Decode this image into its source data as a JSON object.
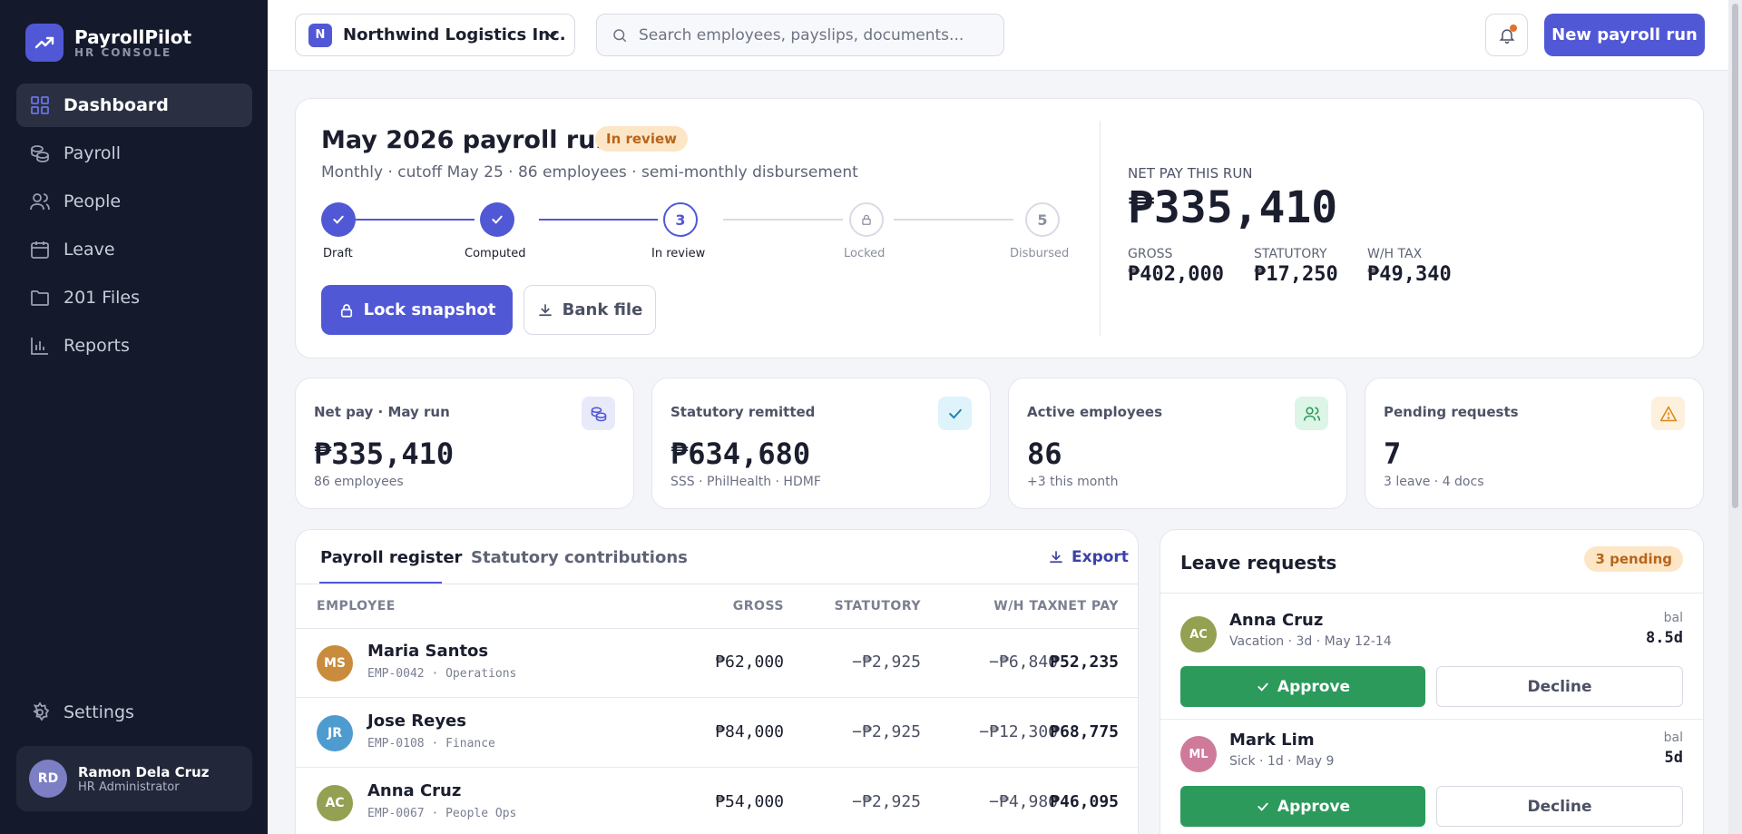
{
  "brand": {
    "name": "PayrollPilot",
    "subtitle": "HR CONSOLE"
  },
  "sidebar": {
    "items": [
      {
        "label": "Dashboard",
        "icon": "grid-icon",
        "active": true
      },
      {
        "label": "Payroll",
        "icon": "coins-icon"
      },
      {
        "label": "People",
        "icon": "users-icon"
      },
      {
        "label": "Leave",
        "icon": "calendar-icon"
      },
      {
        "label": "201 Files",
        "icon": "folder-icon"
      },
      {
        "label": "Reports",
        "icon": "bar-chart-icon"
      }
    ],
    "settings_label": "Settings",
    "user": {
      "initials": "RD",
      "name": "Ramon Dela Cruz",
      "role": "HR Administrator"
    }
  },
  "topbar": {
    "org": {
      "initial": "N",
      "name": "Northwind Logistics Inc."
    },
    "search_placeholder": "Search employees, payslips, documents...",
    "new_run_label": "New payroll run"
  },
  "run": {
    "title": "May 2026 payroll run",
    "status": "In review",
    "subtitle": "Monthly · cutoff May 25 · 86 employees · semi-monthly disbursement",
    "steps": [
      {
        "label": "Draft",
        "state": "done"
      },
      {
        "label": "Computed",
        "state": "done"
      },
      {
        "number": "3",
        "label": "In review",
        "state": "current"
      },
      {
        "label": "Locked",
        "state": "todo"
      },
      {
        "number": "5",
        "label": "Disbursed",
        "state": "todo"
      }
    ],
    "lock_label": "Lock snapshot",
    "bank_label": "Bank file",
    "net_pay_label": "NET PAY THIS RUN",
    "net_pay_value": "₱335,410",
    "breakdown": [
      {
        "label": "GROSS",
        "value": "₱402,000"
      },
      {
        "label": "STATUTORY",
        "value": "₱17,250"
      },
      {
        "label": "W/H TAX",
        "value": "₱49,340"
      }
    ]
  },
  "stats": [
    {
      "label": "Net pay · May run",
      "value": "₱335,410",
      "sub": "86 employees",
      "icon": "coins-icon",
      "color": "#e8eaf9"
    },
    {
      "label": "Statutory remitted",
      "value": "₱634,680",
      "sub": "SSS · PhilHealth · HDMF",
      "icon": "check-icon",
      "color": "#dff3fb"
    },
    {
      "label": "Active employees",
      "value": "86",
      "sub": "+3 this month",
      "icon": "users-icon",
      "color": "#dcf5e6"
    },
    {
      "label": "Pending requests",
      "value": "7",
      "sub": "3 leave · 4 docs",
      "icon": "warning-icon",
      "color": "#fdf0dd"
    }
  ],
  "register": {
    "tabs": [
      "Payroll register",
      "Statutory contributions"
    ],
    "export_label": "Export",
    "columns": [
      "EMPLOYEE",
      "GROSS",
      "STATUTORY",
      "W/H TAX",
      "NET PAY"
    ],
    "rows": [
      {
        "initials": "MS",
        "color": "#c98b3c",
        "name": "Maria Santos",
        "meta": "EMP-0042 · Operations",
        "gross": "₱62,000",
        "statutory": "−₱2,925",
        "tax": "−₱6,840",
        "net": "₱52,235"
      },
      {
        "initials": "JR",
        "color": "#4e9ccf",
        "name": "Jose Reyes",
        "meta": "EMP-0108 · Finance",
        "gross": "₱84,000",
        "statutory": "−₱2,925",
        "tax": "−₱12,300",
        "net": "₱68,775"
      },
      {
        "initials": "AC",
        "color": "#94a052",
        "name": "Anna Cruz",
        "meta": "EMP-0067 · People Ops",
        "gross": "₱54,000",
        "statutory": "−₱2,925",
        "tax": "−₱4,980",
        "net": "₱46,095"
      }
    ]
  },
  "leave": {
    "title": "Leave requests",
    "pending": "3 pending",
    "approve_label": "Approve",
    "decline_label": "Decline",
    "bal_label": "bal",
    "requests": [
      {
        "initials": "AC",
        "color": "#94a052",
        "name": "Anna Cruz",
        "meta": "Vacation · 3d · May 12-14",
        "balance": "8.5d"
      },
      {
        "initials": "ML",
        "color": "#cf7a9a",
        "name": "Mark Lim",
        "meta": "Sick · 1d · May 9",
        "balance": "5d"
      }
    ]
  },
  "colors": {
    "accent": "#5158d6",
    "sidebar": "#141a2c",
    "approve": "#2c9a5b",
    "pending": "#b8651b"
  }
}
